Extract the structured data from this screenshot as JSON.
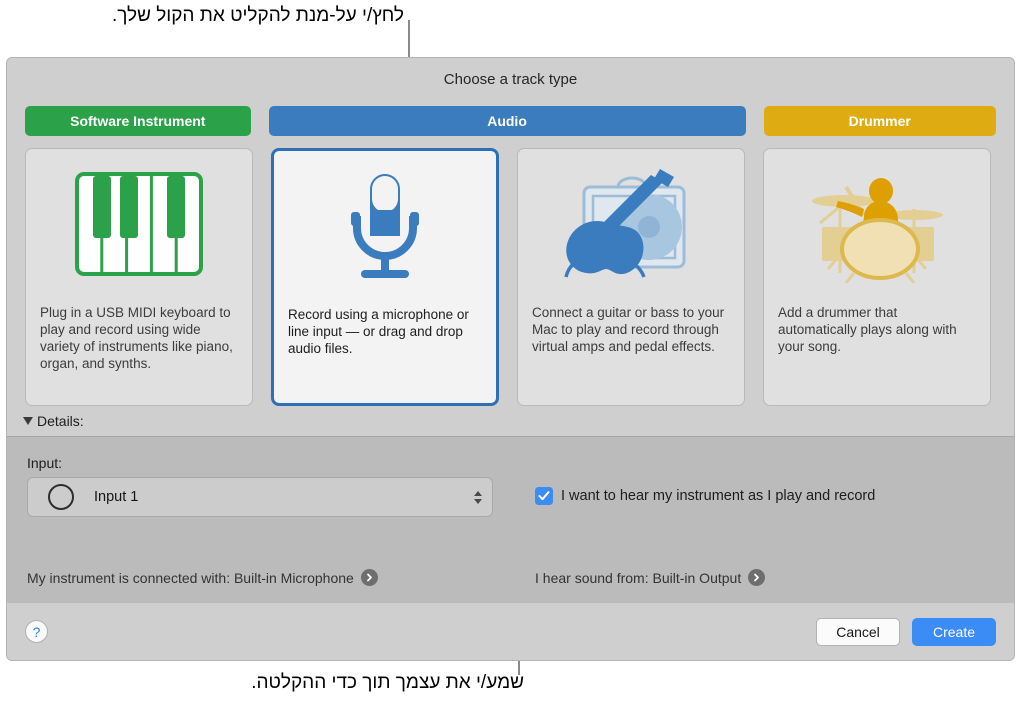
{
  "callouts": {
    "top": "לחץ/י על-מנת להקליט את הקול שלך.",
    "bottom": "שמע/י את עצמך תוך כדי ההקלטה."
  },
  "dialog": {
    "title": "Choose a track type",
    "tabs": [
      {
        "label": "Software Instrument",
        "color": "#2ba14a",
        "selected": false
      },
      {
        "label": "Audio",
        "color": "#3b7cbf",
        "selected": true
      },
      {
        "label": "Drummer",
        "color": "#deab12",
        "selected": false
      }
    ],
    "cards": [
      {
        "icon": "piano-keyboard-icon",
        "description": "Plug in a USB MIDI keyboard to play and record using wide variety of instruments like piano, organ, and synths.",
        "selected": false
      },
      {
        "icon": "microphone-icon",
        "description": "Record using a microphone or line input — or drag and drop audio files.",
        "selected": true
      },
      {
        "icon": "guitar-amp-icon",
        "description": "Connect a guitar or bass to your Mac to play and record through virtual amps and pedal effects.",
        "selected": false
      },
      {
        "icon": "drummer-icon",
        "description": "Add a drummer that automatically plays along with your song.",
        "selected": false
      }
    ],
    "details": {
      "disclosure_label": "Details:",
      "input_label": "Input:",
      "input_value": "Input 1",
      "input_channel_icon": "mono-circle-icon",
      "monitor_checkbox_label": "I want to hear my instrument as I play and record",
      "monitor_checked": true,
      "status_input": "My instrument is connected with: Built-in Microphone",
      "status_output": "I hear sound from: Built-in Output"
    },
    "footer": {
      "help_label": "?",
      "cancel_label": "Cancel",
      "create_label": "Create"
    }
  },
  "colors": {
    "accent_blue": "#3b8cf5",
    "audio_blue": "#3b7cbf",
    "software_green": "#2ba14a",
    "drummer_gold": "#deab12"
  }
}
